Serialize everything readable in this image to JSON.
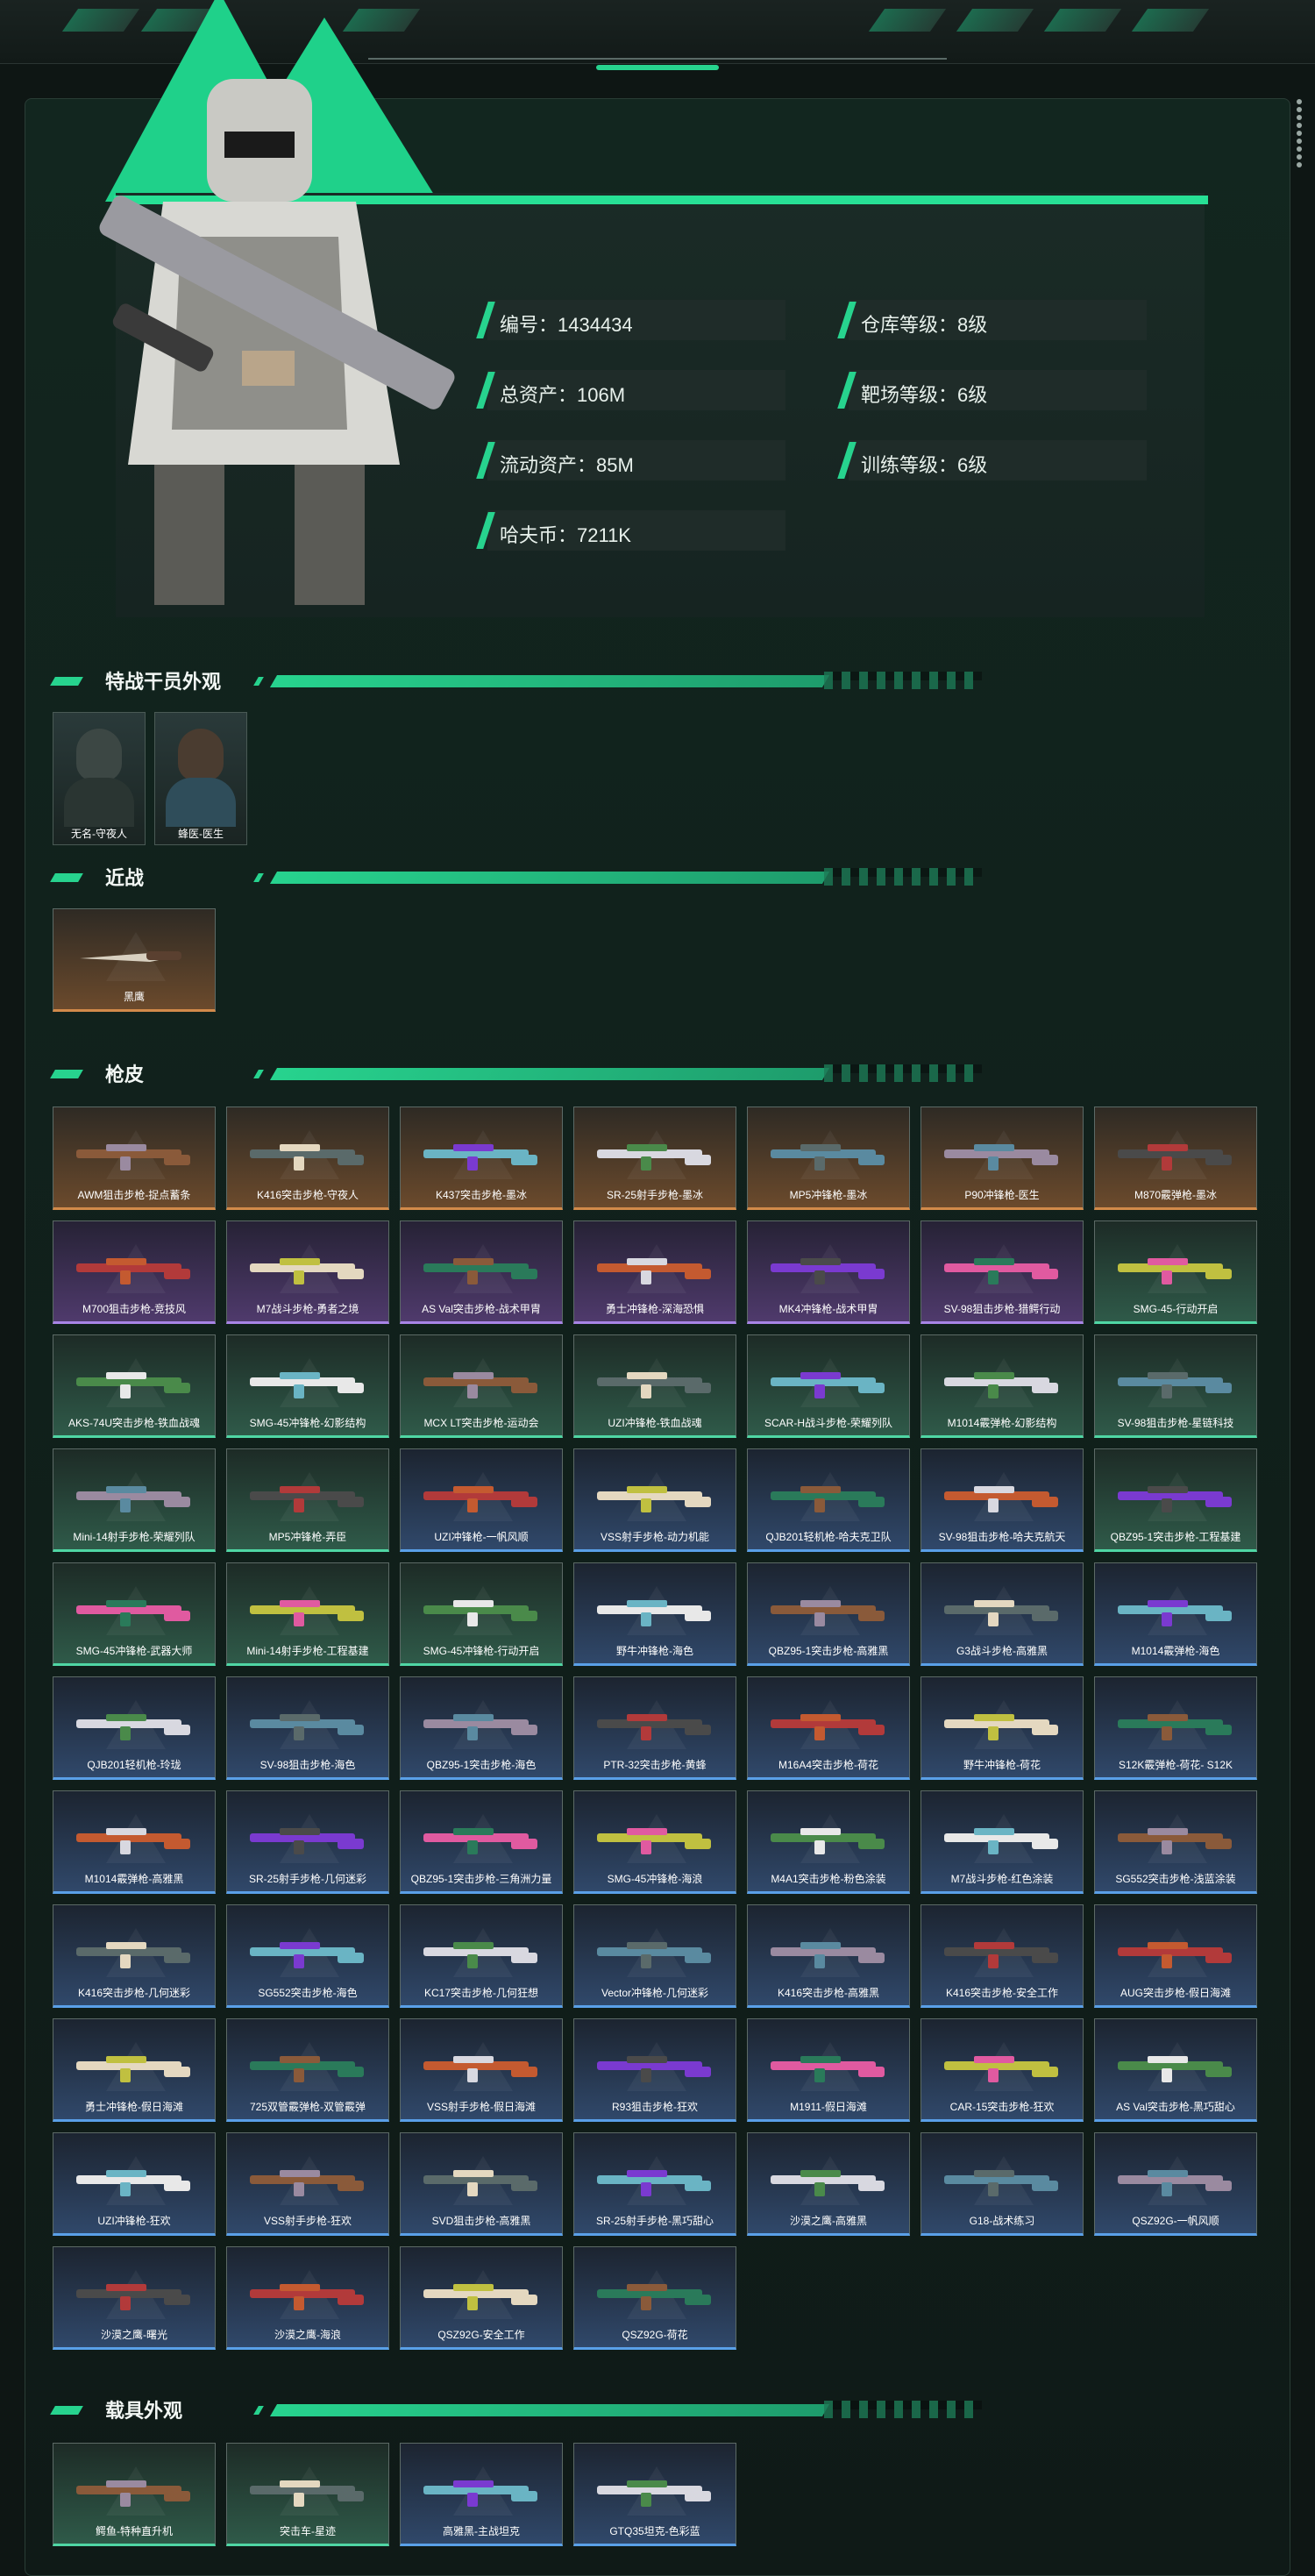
{
  "player": {
    "id": "编号：1434434",
    "total_assets": "总资产：106M",
    "liquid_assets": "流动资产：85M",
    "hafu_coin": "哈夫币：7211K",
    "warehouse_level": "仓库等级：8级",
    "range_level": "靶场等级：6级",
    "training_level": "训练等级：6级"
  },
  "sections": {
    "agents": "特战干员外观",
    "melee": "近战",
    "skins": "枪皮",
    "vehicles": "载具外观"
  },
  "agents": [
    {
      "name": "无名-守夜人"
    },
    {
      "name": "蜂医-医生"
    }
  ],
  "melee": [
    {
      "name": "黑鹰"
    }
  ],
  "skins": [
    {
      "name": "AWM狙击步枪-捉点蓄条",
      "rarity": "gold"
    },
    {
      "name": "K416突击步枪-守夜人",
      "rarity": "gold"
    },
    {
      "name": "K437突击步枪-墨冰",
      "rarity": "gold"
    },
    {
      "name": "SR-25射手步枪-墨冰",
      "rarity": "gold"
    },
    {
      "name": "MP5冲锋枪-墨冰",
      "rarity": "gold"
    },
    {
      "name": "P90冲锋枪-医生",
      "rarity": "gold"
    },
    {
      "name": "M870霰弹枪-墨冰",
      "rarity": "gold"
    },
    {
      "name": "M700狙击步枪-竞技风",
      "rarity": "purple"
    },
    {
      "name": "M7战斗步枪-勇者之境",
      "rarity": "purple"
    },
    {
      "name": "AS Val突击步枪-战术甲胄",
      "rarity": "purple"
    },
    {
      "name": "勇士冲锋枪-深海恐惧",
      "rarity": "purple"
    },
    {
      "name": "MK4冲锋枪-战术甲胄",
      "rarity": "purple"
    },
    {
      "name": "SV-98狙击步枪-猎鳄行动",
      "rarity": "purple"
    },
    {
      "name": "SMG-45-行动开启",
      "rarity": "green"
    },
    {
      "name": "AKS-74U突击步枪-铁血战魂",
      "rarity": "green"
    },
    {
      "name": "SMG-45冲锋枪-幻影结构",
      "rarity": "green"
    },
    {
      "name": "MCX LT突击步枪-运动会",
      "rarity": "green"
    },
    {
      "name": "UZI冲锋枪-铁血战魂",
      "rarity": "green"
    },
    {
      "name": "SCAR-H战斗步枪-荣耀列队",
      "rarity": "green"
    },
    {
      "name": "M1014霰弹枪-幻影结构",
      "rarity": "green"
    },
    {
      "name": "SV-98狙击步枪-星链科技",
      "rarity": "green"
    },
    {
      "name": "Mini-14射手步枪-荣耀列队",
      "rarity": "green"
    },
    {
      "name": "MP5冲锋枪-弄臣",
      "rarity": "green"
    },
    {
      "name": "UZI冲锋枪-一帆风顺",
      "rarity": "blue"
    },
    {
      "name": "VSS射手步枪-动力机能",
      "rarity": "blue"
    },
    {
      "name": "QJB201轻机枪-哈夫克卫队",
      "rarity": "blue"
    },
    {
      "name": "SV-98狙击步枪-哈夫克航天",
      "rarity": "blue"
    },
    {
      "name": "QBZ95-1突击步枪-工程基建",
      "rarity": "green"
    },
    {
      "name": "SMG-45冲锋枪-武器大师",
      "rarity": "green"
    },
    {
      "name": "Mini-14射手步枪-工程基建",
      "rarity": "green"
    },
    {
      "name": "SMG-45冲锋枪-行动开启",
      "rarity": "green"
    },
    {
      "name": "野牛冲锋枪-海色",
      "rarity": "blue"
    },
    {
      "name": "QBZ95-1突击步枪-高雅黑",
      "rarity": "blue"
    },
    {
      "name": "G3战斗步枪-高雅黑",
      "rarity": "blue"
    },
    {
      "name": "M1014霰弹枪-海色",
      "rarity": "blue"
    },
    {
      "name": "QJB201轻机枪-玲珑",
      "rarity": "blue"
    },
    {
      "name": "SV-98狙击步枪-海色",
      "rarity": "blue"
    },
    {
      "name": "QBZ95-1突击步枪-海色",
      "rarity": "blue"
    },
    {
      "name": "PTR-32突击步枪-黄蜂",
      "rarity": "blue"
    },
    {
      "name": "M16A4突击步枪-荷花",
      "rarity": "blue"
    },
    {
      "name": "野牛冲锋枪-荷花",
      "rarity": "blue"
    },
    {
      "name": "S12K霰弹枪-荷花- S12K",
      "rarity": "blue"
    },
    {
      "name": "M1014霰弹枪-高雅黑",
      "rarity": "blue"
    },
    {
      "name": "SR-25射手步枪-几何迷彩",
      "rarity": "blue"
    },
    {
      "name": "QBZ95-1突击步枪-三角洲力量",
      "rarity": "blue"
    },
    {
      "name": "SMG-45冲锋枪-海浪",
      "rarity": "blue"
    },
    {
      "name": "M4A1突击步枪-粉色涂装",
      "rarity": "blue"
    },
    {
      "name": "M7战斗步枪-红色涂装",
      "rarity": "blue"
    },
    {
      "name": "SG552突击步枪-浅蓝涂装",
      "rarity": "blue"
    },
    {
      "name": "K416突击步枪-几何迷彩",
      "rarity": "blue"
    },
    {
      "name": "SG552突击步枪-海色",
      "rarity": "blue"
    },
    {
      "name": "KC17突击步枪-几何狂想",
      "rarity": "blue"
    },
    {
      "name": "Vector冲锋枪-几何迷彩",
      "rarity": "blue"
    },
    {
      "name": "K416突击步枪-高雅黑",
      "rarity": "blue"
    },
    {
      "name": "K416突击步枪-安全工作",
      "rarity": "blue"
    },
    {
      "name": "AUG突击步枪-假日海滩",
      "rarity": "blue"
    },
    {
      "name": "勇士冲锋枪-假日海滩",
      "rarity": "blue"
    },
    {
      "name": "725双管霰弹枪-双管霰弹",
      "rarity": "blue"
    },
    {
      "name": "VSS射手步枪-假日海滩",
      "rarity": "blue"
    },
    {
      "name": "R93狙击步枪-狂欢",
      "rarity": "blue"
    },
    {
      "name": "M1911-假日海滩",
      "rarity": "blue"
    },
    {
      "name": "CAR-15突击步枪-狂欢",
      "rarity": "blue"
    },
    {
      "name": "AS Val突击步枪-黑巧甜心",
      "rarity": "blue"
    },
    {
      "name": "UZI冲锋枪-狂欢",
      "rarity": "blue"
    },
    {
      "name": "VSS射手步枪-狂欢",
      "rarity": "blue"
    },
    {
      "name": "SVD狙击步枪-高雅黑",
      "rarity": "blue"
    },
    {
      "name": "SR-25射手步枪-黑巧甜心",
      "rarity": "blue"
    },
    {
      "name": "沙漠之鹰-高雅黑",
      "rarity": "blue"
    },
    {
      "name": "G18-战术练习",
      "rarity": "blue"
    },
    {
      "name": "QSZ92G-一帆风顺",
      "rarity": "blue"
    },
    {
      "name": "沙漠之鹰-曙光",
      "rarity": "blue"
    },
    {
      "name": "沙漠之鹰-海浪",
      "rarity": "blue"
    },
    {
      "name": "QSZ92G-安全工作",
      "rarity": "blue"
    },
    {
      "name": "QSZ92G-荷花",
      "rarity": "blue"
    }
  ],
  "vehicles": [
    {
      "name": "鳄鱼-特种直升机",
      "rarity": "green"
    },
    {
      "name": "突击车-星迹",
      "rarity": "green"
    },
    {
      "name": "高雅黑-主战坦克",
      "rarity": "blue"
    },
    {
      "name": "GTQ35坦克-色彩蓝",
      "rarity": "blue"
    }
  ],
  "colors": {
    "accent": "#27d38e",
    "gold": "#d28a4a",
    "purple": "#a884e6",
    "green": "#4fd6a4",
    "blue": "#5aa0e8"
  }
}
